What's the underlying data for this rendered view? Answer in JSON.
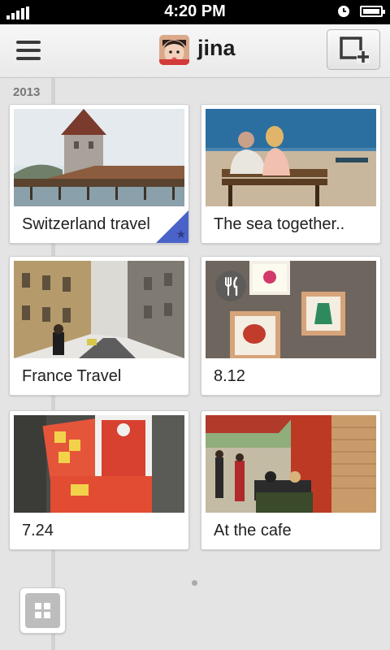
{
  "status_bar": {
    "time": "4:20 PM"
  },
  "header": {
    "user_name": "jina",
    "menu_icon": "hamburger-menu-icon",
    "new_icon": "add-album-icon"
  },
  "timeline": {
    "year": "2013"
  },
  "albums": [
    {
      "title": "Switzerland travel",
      "favorite": true
    },
    {
      "title": "The sea together.."
    },
    {
      "title": "France Travel"
    },
    {
      "title": "8.12",
      "category_icon": "fork-knife-icon"
    },
    {
      "title": "7.24"
    },
    {
      "title": "At the cafe"
    }
  ],
  "colors": {
    "favorite_corner": "#4a63c9",
    "background": "#e4e4e4"
  }
}
